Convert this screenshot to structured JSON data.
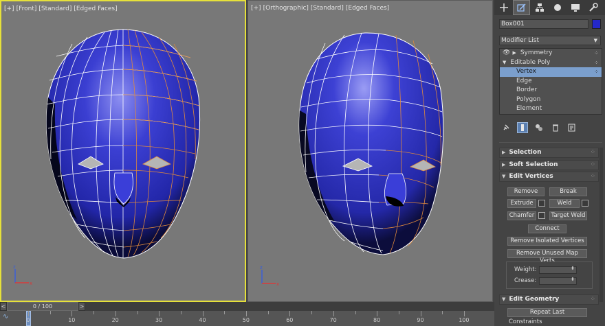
{
  "viewports": [
    {
      "labels": [
        "[+]",
        "[Front]",
        "[Standard]",
        "[Edged Faces]"
      ]
    },
    {
      "labels": [
        "[+]",
        "[Orthographic]",
        "[Standard]",
        "[Edged Faces]"
      ]
    }
  ],
  "command_panel": {
    "tab_icons": [
      "create-icon",
      "modify-icon",
      "hierarchy-icon",
      "motion-icon",
      "display-icon",
      "utilities-icon"
    ],
    "object_name": "Box001",
    "object_color": "#2428c8",
    "modifier_list_label": "Modifier List",
    "stack": [
      {
        "label": "Symmetry"
      },
      {
        "label": "Editable Poly"
      },
      {
        "label": "Vertex"
      },
      {
        "label": "Edge"
      },
      {
        "label": "Border"
      },
      {
        "label": "Polygon"
      },
      {
        "label": "Element"
      }
    ],
    "rollouts": {
      "selection": "Selection",
      "soft_selection": "Soft Selection",
      "edit_vertices": "Edit Vertices",
      "edit_geometry": "Edit Geometry"
    },
    "edit_vertices": {
      "remove": "Remove",
      "break": "Break",
      "extrude": "Extrude",
      "weld": "Weld",
      "chamfer": "Chamfer",
      "target_weld": "Target Weld",
      "connect": "Connect",
      "remove_isolated": "Remove Isolated Vertices",
      "remove_unused": "Remove Unused Map Verts",
      "weight_label": "Weight:",
      "crease_label": "Crease:"
    },
    "edit_geometry": {
      "repeat_last": "Repeat Last",
      "constraints": "Constraints"
    }
  },
  "timeline": {
    "frame_display": "0 / 100",
    "prev_label": "<",
    "next_label": ">",
    "ticks": [
      "0",
      "10",
      "20",
      "30",
      "40",
      "50",
      "60",
      "70",
      "80",
      "90",
      "100"
    ]
  },
  "colors": {
    "mesh_fill": "#2f33c9",
    "wire_white": "#ffffff",
    "wire_orange": "#e08a3c",
    "active_viewport_border": "#e6e13a",
    "selection_highlight": "#7b9fcd"
  }
}
